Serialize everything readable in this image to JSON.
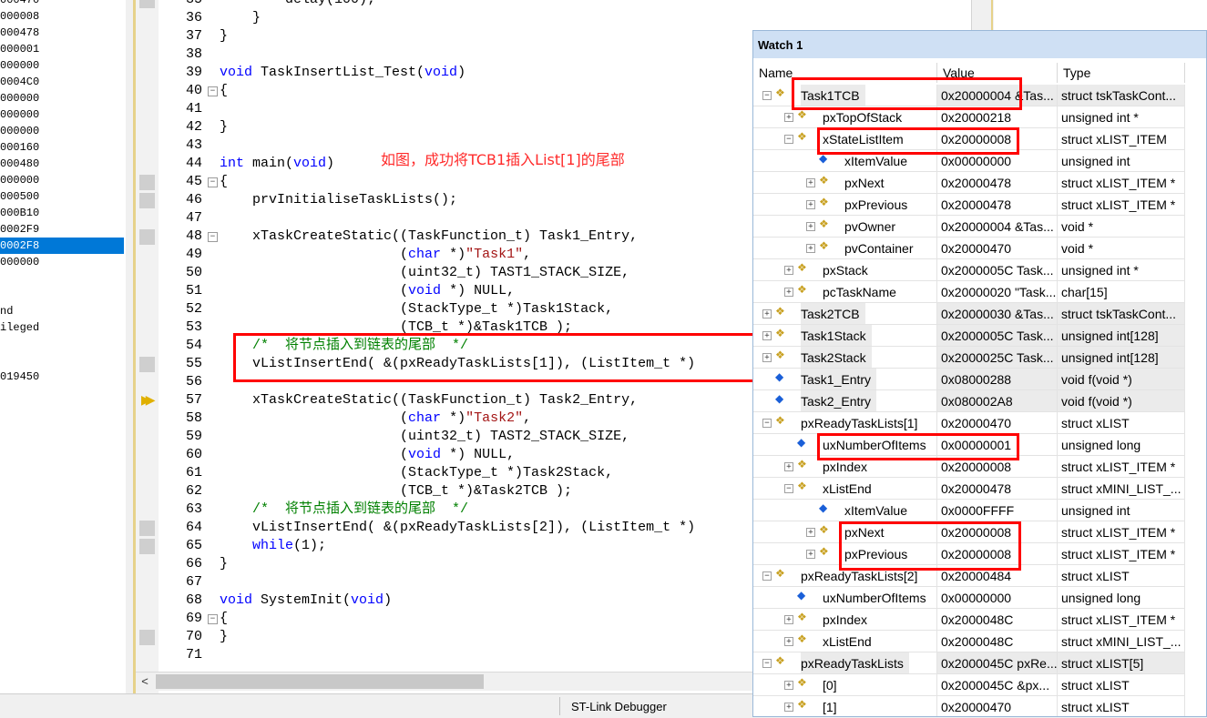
{
  "registers": [
    {
      "text": "000470",
      "selected": false
    },
    {
      "text": "000008",
      "selected": false
    },
    {
      "text": "000478",
      "selected": false
    },
    {
      "text": "000001",
      "selected": false
    },
    {
      "text": "000000",
      "selected": false
    },
    {
      "text": "0004C0",
      "selected": false
    },
    {
      "text": "000000",
      "selected": false
    },
    {
      "text": "000000",
      "selected": false
    },
    {
      "text": "000000",
      "selected": false
    },
    {
      "text": "000160",
      "selected": false
    },
    {
      "text": "000480",
      "selected": false
    },
    {
      "text": "000000",
      "selected": false
    },
    {
      "text": "000500",
      "selected": false
    },
    {
      "text": "000B10",
      "selected": false
    },
    {
      "text": "0002F9",
      "selected": false
    },
    {
      "text": "0002F8",
      "selected": true
    },
    {
      "text": "000000",
      "selected": false
    },
    {
      "text": "",
      "selected": false
    },
    {
      "text": "",
      "selected": false
    },
    {
      "text": "nd",
      "selected": false
    },
    {
      "text": "ileged",
      "selected": false
    },
    {
      "text": "",
      "selected": false
    },
    {
      "text": "",
      "selected": false
    },
    {
      "text": "019450",
      "selected": false
    }
  ],
  "editor": {
    "annotation": "如图，成功将TCB1插入List[1]的尾部",
    "lines": [
      {
        "num": "35",
        "segs": [
          {
            "t": "        delay(100);",
            "c": ""
          }
        ]
      },
      {
        "num": "36",
        "segs": [
          {
            "t": "    }",
            "c": ""
          }
        ]
      },
      {
        "num": "37",
        "segs": [
          {
            "t": "}",
            "c": ""
          }
        ]
      },
      {
        "num": "38",
        "segs": [
          {
            "t": "",
            "c": ""
          }
        ]
      },
      {
        "num": "39",
        "segs": [
          {
            "t": "void",
            "c": "kw"
          },
          {
            "t": " TaskInsertList_Test(",
            "c": ""
          },
          {
            "t": "void",
            "c": "kw"
          },
          {
            "t": ")",
            "c": ""
          }
        ]
      },
      {
        "num": "40",
        "segs": [
          {
            "t": "{",
            "c": ""
          }
        ]
      },
      {
        "num": "41",
        "segs": [
          {
            "t": "",
            "c": ""
          }
        ]
      },
      {
        "num": "42",
        "segs": [
          {
            "t": "}",
            "c": ""
          }
        ]
      },
      {
        "num": "43",
        "segs": [
          {
            "t": "",
            "c": ""
          }
        ]
      },
      {
        "num": "44",
        "segs": [
          {
            "t": "int",
            "c": "kw"
          },
          {
            "t": " main(",
            "c": ""
          },
          {
            "t": "void",
            "c": "kw"
          },
          {
            "t": ")",
            "c": ""
          }
        ]
      },
      {
        "num": "45",
        "segs": [
          {
            "t": "{",
            "c": ""
          }
        ]
      },
      {
        "num": "46",
        "segs": [
          {
            "t": "    prvInitialiseTaskLists();",
            "c": ""
          }
        ]
      },
      {
        "num": "47",
        "segs": [
          {
            "t": "",
            "c": ""
          }
        ]
      },
      {
        "num": "48",
        "segs": [
          {
            "t": "    xTaskCreateStatic((TaskFunction_t) Task1_Entry,",
            "c": ""
          }
        ]
      },
      {
        "num": "49",
        "segs": [
          {
            "t": "                      (",
            "c": ""
          },
          {
            "t": "char",
            "c": "kw"
          },
          {
            "t": " *)",
            "c": ""
          },
          {
            "t": "\"Task1\"",
            "c": "str"
          },
          {
            "t": ",",
            "c": ""
          }
        ]
      },
      {
        "num": "50",
        "segs": [
          {
            "t": "                      (uint32_t) TAST1_STACK_SIZE,",
            "c": ""
          }
        ]
      },
      {
        "num": "51",
        "segs": [
          {
            "t": "                      (",
            "c": ""
          },
          {
            "t": "void",
            "c": "kw"
          },
          {
            "t": " *) NULL,",
            "c": ""
          }
        ]
      },
      {
        "num": "52",
        "segs": [
          {
            "t": "                      (StackType_t *)Task1Stack,",
            "c": ""
          }
        ]
      },
      {
        "num": "53",
        "segs": [
          {
            "t": "                      (TCB_t *)&Task1TCB );",
            "c": ""
          }
        ]
      },
      {
        "num": "54",
        "segs": [
          {
            "t": "    /*  将节点插入到链表的尾部  */",
            "c": "cmt"
          }
        ]
      },
      {
        "num": "55",
        "segs": [
          {
            "t": "    vListInsertEnd( &(pxReadyTaskLists[1]), (ListItem_t *)",
            "c": ""
          }
        ]
      },
      {
        "num": "56",
        "segs": [
          {
            "t": "",
            "c": ""
          }
        ]
      },
      {
        "num": "57",
        "segs": [
          {
            "t": "    xTaskCreateStatic((TaskFunction_t) Task2_Entry,",
            "c": ""
          }
        ]
      },
      {
        "num": "58",
        "segs": [
          {
            "t": "                      (",
            "c": ""
          },
          {
            "t": "char",
            "c": "kw"
          },
          {
            "t": " *)",
            "c": ""
          },
          {
            "t": "\"Task2\"",
            "c": "str"
          },
          {
            "t": ",",
            "c": ""
          }
        ]
      },
      {
        "num": "59",
        "segs": [
          {
            "t": "                      (uint32_t) TAST2_STACK_SIZE,",
            "c": ""
          }
        ]
      },
      {
        "num": "60",
        "segs": [
          {
            "t": "                      (",
            "c": ""
          },
          {
            "t": "void",
            "c": "kw"
          },
          {
            "t": " *) NULL,",
            "c": ""
          }
        ]
      },
      {
        "num": "61",
        "segs": [
          {
            "t": "                      (StackType_t *)Task2Stack,",
            "c": ""
          }
        ]
      },
      {
        "num": "62",
        "segs": [
          {
            "t": "                      (TCB_t *)&Task2TCB );",
            "c": ""
          }
        ]
      },
      {
        "num": "63",
        "segs": [
          {
            "t": "    /*  将节点插入到链表的尾部  */",
            "c": "cmt"
          }
        ]
      },
      {
        "num": "64",
        "segs": [
          {
            "t": "    vListInsertEnd( &(pxReadyTaskLists[2]), (ListItem_t *)",
            "c": ""
          }
        ]
      },
      {
        "num": "65",
        "segs": [
          {
            "t": "    ",
            "c": ""
          },
          {
            "t": "while",
            "c": "kw"
          },
          {
            "t": "(1);",
            "c": ""
          }
        ]
      },
      {
        "num": "66",
        "segs": [
          {
            "t": "}",
            "c": ""
          }
        ]
      },
      {
        "num": "67",
        "segs": [
          {
            "t": "",
            "c": ""
          }
        ]
      },
      {
        "num": "68",
        "segs": [
          {
            "t": "void",
            "c": "kw"
          },
          {
            "t": " SystemInit(",
            "c": ""
          },
          {
            "t": "void",
            "c": "kw"
          },
          {
            "t": ")",
            "c": ""
          }
        ]
      },
      {
        "num": "69",
        "segs": [
          {
            "t": "{",
            "c": ""
          }
        ]
      },
      {
        "num": "70",
        "segs": [
          {
            "t": "}",
            "c": ""
          }
        ]
      },
      {
        "num": "71",
        "segs": [
          {
            "t": "",
            "c": ""
          }
        ]
      }
    ]
  },
  "status": {
    "debugger": "ST-Link Debugger"
  },
  "watch": {
    "title": "Watch 1",
    "headers": {
      "name": "Name",
      "value": "Value",
      "type": "Type"
    },
    "rows": [
      {
        "depth": 0,
        "exp": "−",
        "icon": "struct",
        "name": "Task1TCB",
        "value": "0x20000004 &Tas...",
        "type": "struct tskTaskCont...",
        "grey": true
      },
      {
        "depth": 1,
        "exp": "+",
        "icon": "struct",
        "name": "pxTopOfStack",
        "value": "0x20000218",
        "type": "unsigned int *",
        "grey": false
      },
      {
        "depth": 1,
        "exp": "−",
        "icon": "struct",
        "name": "xStateListItem",
        "value": "0x20000008",
        "type": "struct xLIST_ITEM",
        "grey": false
      },
      {
        "depth": 2,
        "exp": "",
        "icon": "var",
        "name": "xItemValue",
        "value": "0x00000000",
        "type": "unsigned int",
        "grey": false
      },
      {
        "depth": 2,
        "exp": "+",
        "icon": "struct",
        "name": "pxNext",
        "value": "0x20000478",
        "type": "struct xLIST_ITEM *",
        "grey": false
      },
      {
        "depth": 2,
        "exp": "+",
        "icon": "struct",
        "name": "pxPrevious",
        "value": "0x20000478",
        "type": "struct xLIST_ITEM *",
        "grey": false
      },
      {
        "depth": 2,
        "exp": "+",
        "icon": "struct",
        "name": "pvOwner",
        "value": "0x20000004 &Tas...",
        "type": "void *",
        "grey": false
      },
      {
        "depth": 2,
        "exp": "+",
        "icon": "struct",
        "name": "pvContainer",
        "value": "0x20000470",
        "type": "void *",
        "grey": false
      },
      {
        "depth": 1,
        "exp": "+",
        "icon": "struct",
        "name": "pxStack",
        "value": "0x2000005C Task...",
        "type": "unsigned int *",
        "grey": false
      },
      {
        "depth": 1,
        "exp": "+",
        "icon": "struct",
        "name": "pcTaskName",
        "value": "0x20000020 \"Task...",
        "type": "char[15]",
        "grey": false
      },
      {
        "depth": 0,
        "exp": "+",
        "icon": "struct",
        "name": "Task2TCB",
        "value": "0x20000030 &Tas...",
        "type": "struct tskTaskCont...",
        "grey": true
      },
      {
        "depth": 0,
        "exp": "+",
        "icon": "struct",
        "name": "Task1Stack",
        "value": "0x2000005C Task...",
        "type": "unsigned int[128]",
        "grey": true
      },
      {
        "depth": 0,
        "exp": "+",
        "icon": "struct",
        "name": "Task2Stack",
        "value": "0x2000025C Task...",
        "type": "unsigned int[128]",
        "grey": true
      },
      {
        "depth": 0,
        "exp": "",
        "icon": "var",
        "name": "Task1_Entry",
        "value": "0x08000288",
        "type": "void f(void *)",
        "grey": true
      },
      {
        "depth": 0,
        "exp": "",
        "icon": "var",
        "name": "Task2_Entry",
        "value": "0x080002A8",
        "type": "void f(void *)",
        "grey": true
      },
      {
        "depth": 0,
        "exp": "−",
        "icon": "struct",
        "name": "pxReadyTaskLists[1]",
        "value": "0x20000470",
        "type": "struct xLIST",
        "grey": false
      },
      {
        "depth": 1,
        "exp": "",
        "icon": "var",
        "name": "uxNumberOfItems",
        "value": "0x00000001",
        "type": "unsigned long",
        "grey": false
      },
      {
        "depth": 1,
        "exp": "+",
        "icon": "struct",
        "name": "pxIndex",
        "value": "0x20000008",
        "type": "struct xLIST_ITEM *",
        "grey": false
      },
      {
        "depth": 1,
        "exp": "−",
        "icon": "struct",
        "name": "xListEnd",
        "value": "0x20000478",
        "type": "struct xMINI_LIST_...",
        "grey": false
      },
      {
        "depth": 2,
        "exp": "",
        "icon": "var",
        "name": "xItemValue",
        "value": "0x0000FFFF",
        "type": "unsigned int",
        "grey": false
      },
      {
        "depth": 2,
        "exp": "+",
        "icon": "struct",
        "name": "pxNext",
        "value": "0x20000008",
        "type": "struct xLIST_ITEM *",
        "grey": false
      },
      {
        "depth": 2,
        "exp": "+",
        "icon": "struct",
        "name": "pxPrevious",
        "value": "0x20000008",
        "type": "struct xLIST_ITEM *",
        "grey": false
      },
      {
        "depth": 0,
        "exp": "−",
        "icon": "struct",
        "name": "pxReadyTaskLists[2]",
        "value": "0x20000484",
        "type": "struct xLIST",
        "grey": false
      },
      {
        "depth": 1,
        "exp": "",
        "icon": "var",
        "name": "uxNumberOfItems",
        "value": "0x00000000",
        "type": "unsigned long",
        "grey": false
      },
      {
        "depth": 1,
        "exp": "+",
        "icon": "struct",
        "name": "pxIndex",
        "value": "0x2000048C",
        "type": "struct xLIST_ITEM *",
        "grey": false
      },
      {
        "depth": 1,
        "exp": "+",
        "icon": "struct",
        "name": "xListEnd",
        "value": "0x2000048C",
        "type": "struct xMINI_LIST_...",
        "grey": false
      },
      {
        "depth": 0,
        "exp": "−",
        "icon": "struct",
        "name": "pxReadyTaskLists",
        "value": "0x2000045C pxRe...",
        "type": "struct xLIST[5]",
        "grey": true
      },
      {
        "depth": 1,
        "exp": "+",
        "icon": "struct",
        "name": "[0]",
        "value": "0x2000045C &px...",
        "type": "struct xLIST",
        "grey": false
      },
      {
        "depth": 1,
        "exp": "+",
        "icon": "struct",
        "name": "[1]",
        "value": "0x20000470",
        "type": "struct xLIST",
        "grey": false
      }
    ]
  }
}
